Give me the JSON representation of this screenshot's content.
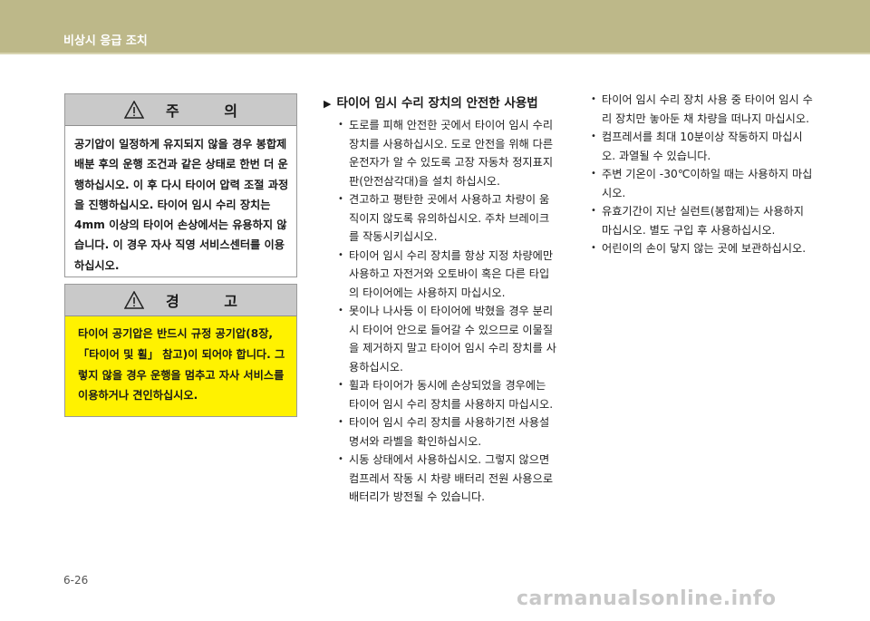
{
  "header": {
    "title": "비상시 응급 조치"
  },
  "caution": {
    "title": "주 의",
    "text": "공기압이 일정하게 유지되지 않을 경우 봉합제 배분 후의 운행 조건과 같은 상태로 한번 더 운행하십시오. 이 후 다시 타이어 압력 조절 과정을 진행하십시오. 타이어 임시 수리 장치는 4mm 이상의 타이어 손상에서는 유용하지 않습니다. 이 경우 자사 직영 서비스센터를 이용하십시오."
  },
  "warning": {
    "title": "경 고",
    "text": "타이어 공기압은 반드시 규정 공기압(8장, 「타이어 및 휠」 참고)이 되어야 합니다. 그렇지 않을 경우 운행을 멈추고 자사 서비스를 이용하거나 견인하십시오."
  },
  "section": {
    "marker": "▶",
    "title": "타이어 임시 수리 장치의 안전한 사용법"
  },
  "col2_items": [
    "도로를 피해 안전한 곳에서 타이어 임시 수리 장치를 사용하십시오. 도로 안전을 위해 다른 운전자가 알 수 있도록 고장 자동차 정지표지판(안전삼각대)을 설치 하십시오.",
    "견고하고 평탄한 곳에서 사용하고 차량이 움직이지 않도록 유의하십시오. 주차 브레이크를 작동시키십시오.",
    "타이어 임시 수리 장치를 항상 지정 차량에만 사용하고 자전거와 오토바이 혹은 다른 타입의 타이어에는 사용하지 마십시오.",
    "못이나 나사등 이 타이어에 박혔을 경우 분리 시 타이어 안으로 들어갈 수 있으므로 이물질을 제거하지 말고 타이어 임시 수리 장치를 사용하십시오.",
    "휠과 타이어가 동시에 손상되었을 경우에는 타이어 임시 수리 장치를 사용하지 마십시오.",
    "타이어 임시 수리 장치를 사용하기전 사용설명서와 라벨을 확인하십시오.",
    "시동 상태에서 사용하십시오. 그렇지 않으면 컴프레서 작동 시 차량 배터리 전원 사용으로 배터리가 방전될 수 있습니다."
  ],
  "col3_items": [
    "타이어 임시 수리 장치 사용 중 타이어 임시 수리 장치만 놓아둔 채 차량을 떠나지 마십시오.",
    "컴프레서를 최대 10분이상 작동하지 마십시오. 과열될 수 있습니다.",
    "주변 기온이 -30℃이하일 때는 사용하지 마십시오.",
    "유효기간이 지난 실런트(봉합제)는 사용하지 마십시오. 별도 구입 후 사용하십시오.",
    "어린이의 손이 닿지 않는 곳에 보관하십시오."
  ],
  "footer": {
    "page_number": "6-26",
    "watermark": "carmanualsonline.info"
  },
  "icons": [
    "warning-triangle-icon",
    "play-arrow-icon"
  ]
}
